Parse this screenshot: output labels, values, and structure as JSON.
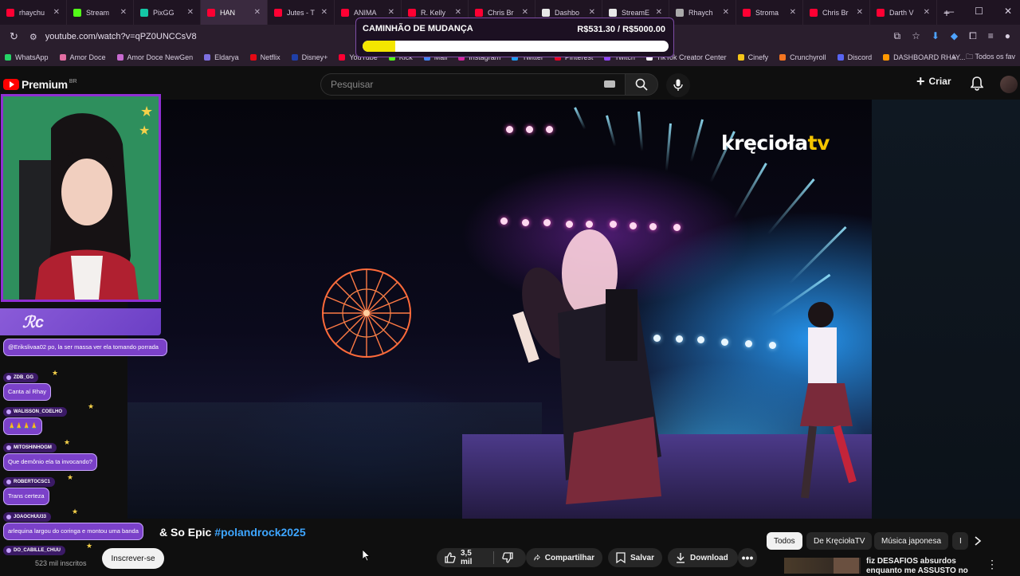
{
  "tabs": [
    {
      "label": "rhaychu",
      "color": "#ff0033"
    },
    {
      "label": "Stream",
      "color": "#53fc18"
    },
    {
      "label": "PixGG",
      "color": "#14c7a6"
    },
    {
      "label": "HAN",
      "color": "#ff0033"
    },
    {
      "label": "Jutes - T",
      "color": "#ff0033"
    },
    {
      "label": "ANIMA",
      "color": "#ff0033"
    },
    {
      "label": "R. Kelly",
      "color": "#ff0033"
    },
    {
      "label": "Chris Br",
      "color": "#ff0033"
    },
    {
      "label": "Dashbo",
      "color": "#e8e8e8"
    },
    {
      "label": "StreamE",
      "color": "#e8e8e8"
    },
    {
      "label": "Rhaych",
      "color": "#aaaaaa"
    },
    {
      "label": "Stroma",
      "color": "#ff0033"
    },
    {
      "label": "Chris Br",
      "color": "#ff0033"
    },
    {
      "label": "Darth V",
      "color": "#ff0033"
    }
  ],
  "active_tab_index": 3,
  "address": {
    "url": "youtube.com/watch?v=qPZ0UNCCsV8"
  },
  "bookmarks": [
    {
      "label": "WhatsApp",
      "color": "#25d366"
    },
    {
      "label": "Amor Doce",
      "color": "#e36ea3"
    },
    {
      "label": "Amor Doce NewGen",
      "color": "#c86ad0"
    },
    {
      "label": "Eldarya",
      "color": "#7d6fe0"
    },
    {
      "label": "Netflix",
      "color": "#e50914"
    },
    {
      "label": "Disney+",
      "color": "#1f3fa8"
    },
    {
      "label": "YouTube",
      "color": "#ff0033"
    },
    {
      "label": "Kick",
      "color": "#53fc18"
    },
    {
      "label": "Mail",
      "color": "#4285f4"
    },
    {
      "label": "Instagram",
      "color": "#d6249f"
    },
    {
      "label": "Twitter",
      "color": "#1d9bf0"
    },
    {
      "label": "Pinterest",
      "color": "#e60023"
    },
    {
      "label": "Twitch",
      "color": "#9146ff"
    },
    {
      "label": "TikTok Creator Center",
      "color": "#ffffff"
    },
    {
      "label": "Cinefy",
      "color": "#f5c518"
    },
    {
      "label": "Crunchyroll",
      "color": "#f47521"
    },
    {
      "label": "Discord",
      "color": "#5865f2"
    },
    {
      "label": "DASHBOARD RHAY...",
      "color": "#ff9800"
    }
  ],
  "bookmarks_all": "Todos os fav",
  "goal": {
    "title": "CAMINHÃO DE MUDANÇA",
    "amount": "R$531.30 / R$5000.00",
    "progress": 0.106
  },
  "youtube": {
    "brand": "Premium",
    "region": "BR",
    "search_placeholder": "Pesquisar",
    "create_label": "Criar"
  },
  "video": {
    "watermark_main": "kręcioła",
    "watermark_tv": "tv"
  },
  "chat": {
    "messages": [
      {
        "user": "",
        "text": "@Erikslivaa02 po, la ser massa ver ela tomando porrada"
      },
      {
        "user": "ZDB_GG",
        "text": "Canta aí Rhay"
      },
      {
        "user": "WALISSON_COELHO",
        "text": "🙏🙏🙏🙏"
      },
      {
        "user": "MITOSHINHOGM",
        "text": "Que demônio ela ta invocando?"
      },
      {
        "user": "ROBERTOCSC1",
        "text": "Trans certeza"
      },
      {
        "user": "JOAOCHUU33",
        "text": "arlequina largou do coringa e montou uma banda"
      },
      {
        "user": "DO_CABILLE_CHUU",
        "text": ""
      }
    ]
  },
  "watch": {
    "title_text": "& So Epic ",
    "title_hashtag": "#polandrock2025",
    "subscribers": "523 mil inscritos",
    "subscribe_label": "Inscrever-se",
    "likes": "3,5 mil",
    "share_label": "Compartilhar",
    "save_label": "Salvar",
    "download_label": "Download"
  },
  "chips": [
    "Todos",
    "De KręciołaTV",
    "Música japonesa",
    "I"
  ],
  "suggestion": {
    "title": "fiz DESAFIOS absurdos enquanto me ASSUSTO no"
  }
}
